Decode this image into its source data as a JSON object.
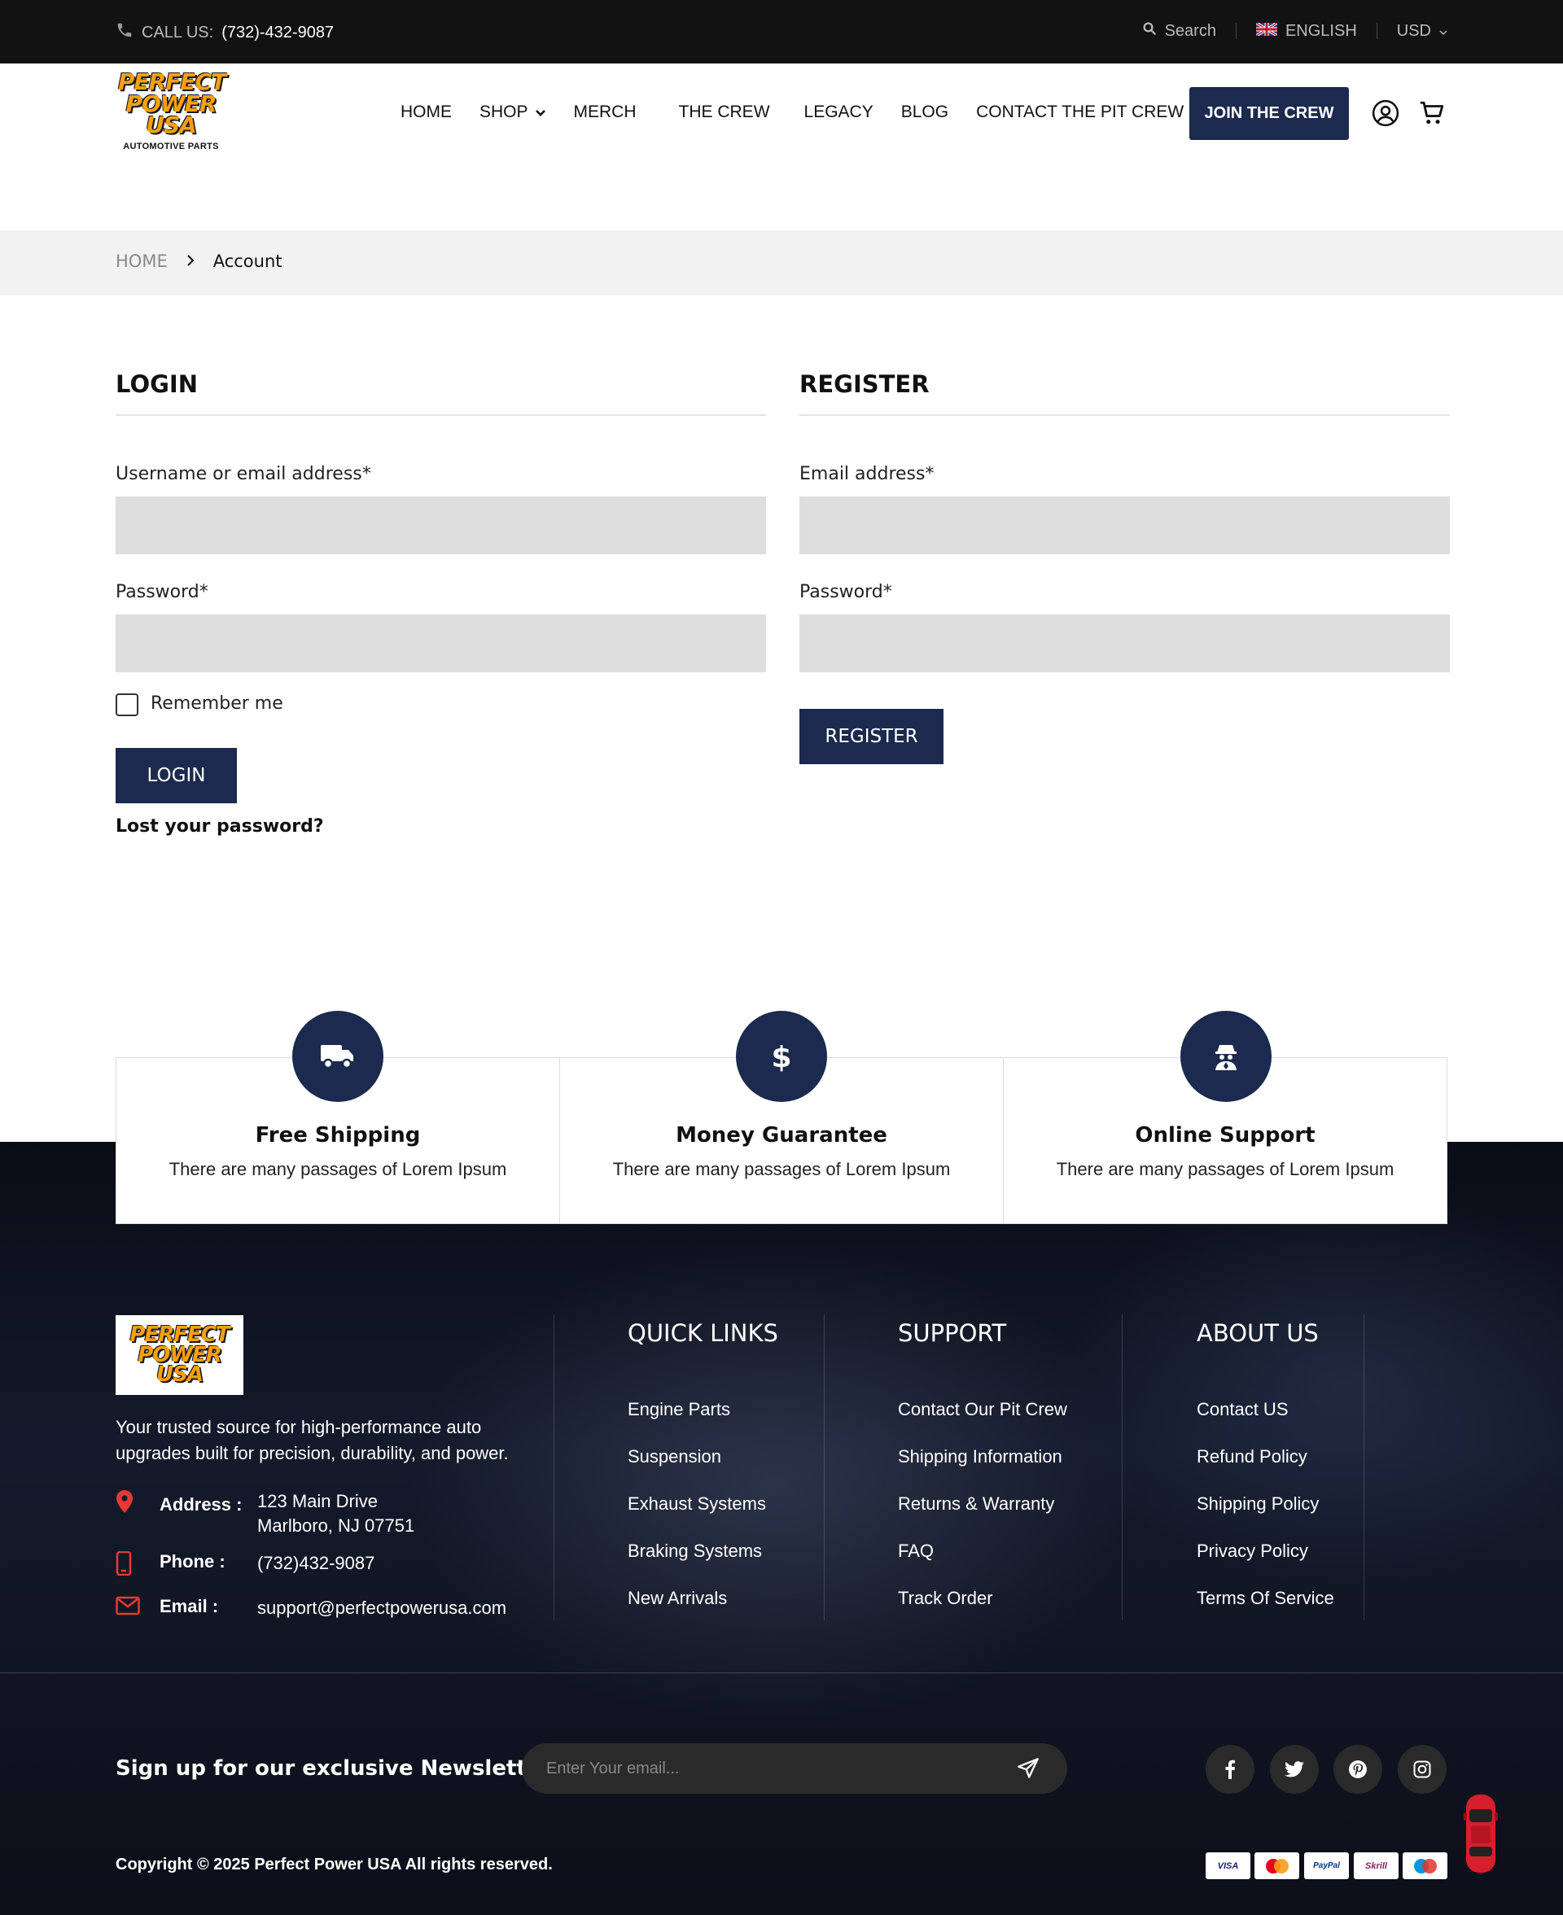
{
  "topbar": {
    "call_label": "CALL US:",
    "phone": "(732)-432-9087",
    "search_label": "Search",
    "language": "ENGLISH",
    "currency": "USD"
  },
  "header": {
    "logo_line1": "PERFECT",
    "logo_line2": "POWER",
    "logo_line3": "USA",
    "logo_tagline": "AUTOMOTIVE PARTS",
    "nav": [
      "HOME",
      "SHOP",
      "MERCH",
      "THE CREW",
      "LEGACY",
      "BLOG",
      "CONTACT THE PIT CREW"
    ],
    "cta": "JOIN THE CREW"
  },
  "breadcrumb": {
    "home": "HOME",
    "current": "Account"
  },
  "login": {
    "title": "LOGIN",
    "username_label": "Username or email address*",
    "password_label": "Password*",
    "remember_label": "Remember me",
    "button": "LOGIN",
    "lost_password": "Lost your password?"
  },
  "register": {
    "title": "REGISTER",
    "email_label": "Email address*",
    "password_label": "Password*",
    "button": "REGISTER"
  },
  "features": [
    {
      "icon": "truck-icon",
      "title": "Free Shipping",
      "desc": "There are many passages of Lorem Ipsum"
    },
    {
      "icon": "dollar-icon",
      "title": "Money Guarantee",
      "desc": "There are many passages of Lorem Ipsum"
    },
    {
      "icon": "support-agent-icon",
      "title": "Online Support",
      "desc": "There are many passages of Lorem Ipsum"
    }
  ],
  "footer": {
    "about_text_1": "Your trusted source for high-performance auto",
    "about_text_2": "upgrades built for precision, durability, and power.",
    "address_label": "Address :",
    "address_line1": "123 Main Drive",
    "address_line2": "Marlboro, NJ 07751",
    "phone_label": "Phone :",
    "phone": "(732)432-9087",
    "email_label": "Email :",
    "email": "support@perfectpowerusa.com",
    "quick_links": {
      "title": "QUICK LINKS",
      "items": [
        "Engine Parts",
        "Suspension",
        "Exhaust Systems",
        "Braking Systems",
        "New Arrivals"
      ]
    },
    "support": {
      "title": "SUPPORT",
      "items": [
        "Contact Our Pit Crew",
        "Shipping Information",
        "Returns & Warranty",
        "FAQ",
        "Track Order"
      ]
    },
    "about": {
      "title": "ABOUT US",
      "items": [
        "Contact US",
        "Refund Policy",
        "Shipping Policy",
        "Privacy Policy",
        "Terms Of Service"
      ]
    },
    "newsletter_title": "Sign up for our exclusive Newsletter",
    "newsletter_placeholder": "Enter Your email...",
    "copyright": "Copyright © 2025  Perfect Power USA  All rights reserved.",
    "payments": [
      "VISA",
      "MasterCard",
      "PayPal",
      "Skrill",
      "Maestro"
    ]
  },
  "colors": {
    "primary": "#1b2a4e",
    "accent": "#f6a00f",
    "icon_red": "#e53935",
    "topbar": "#121212"
  }
}
